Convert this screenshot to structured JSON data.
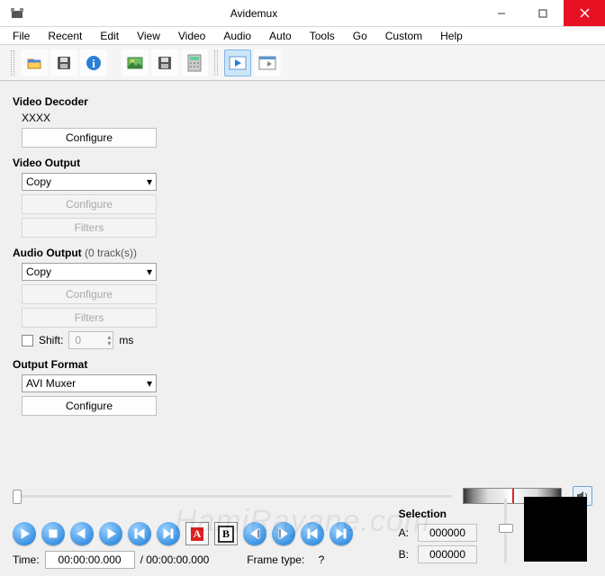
{
  "window": {
    "title": "Avidemux"
  },
  "menu": [
    "File",
    "Recent",
    "Edit",
    "View",
    "Video",
    "Audio",
    "Auto",
    "Tools",
    "Go",
    "Custom",
    "Help"
  ],
  "tools": {
    "open": "open-file-icon",
    "save": "save-icon",
    "info": "info-icon",
    "picture": "picture-icon",
    "savealt": "save-alt-icon",
    "calc": "calculator-icon",
    "playwin": "play-window-icon",
    "winlist": "window-list-icon"
  },
  "decoder": {
    "title": "Video Decoder",
    "codec": "XXXX",
    "configure": "Configure"
  },
  "video_out": {
    "title": "Video Output",
    "value": "Copy",
    "configure": "Configure",
    "filters": "Filters"
  },
  "audio_out": {
    "title": "Audio Output",
    "tracks": "(0 track(s))",
    "value": "Copy",
    "configure": "Configure",
    "filters": "Filters",
    "shift_label": "Shift:",
    "shift_value": "0",
    "shift_unit": "ms"
  },
  "format": {
    "title": "Output Format",
    "value": "AVI Muxer",
    "configure": "Configure"
  },
  "time": {
    "label": "Time:",
    "current": "00:00:00.000",
    "total": "/ 00:00:00.000",
    "frametype_label": "Frame type:",
    "frametype_value": "?"
  },
  "selection": {
    "title": "Selection",
    "a_label": "A:",
    "a_value": "000000",
    "b_label": "B:",
    "b_value": "000000"
  },
  "watermark": "HamiRayane.com"
}
